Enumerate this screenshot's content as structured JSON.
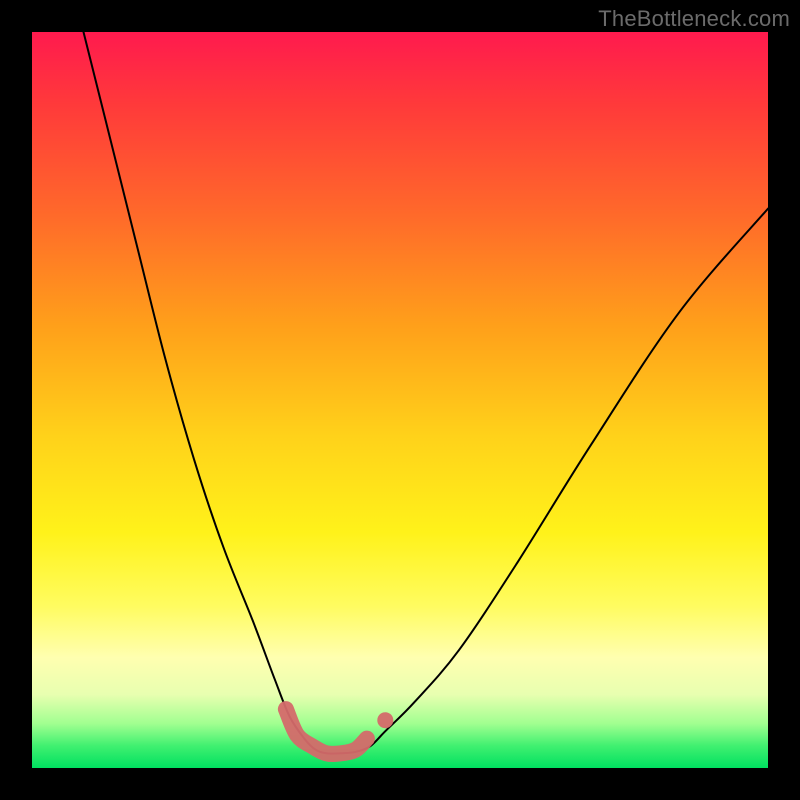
{
  "watermark": "TheBottleneck.com",
  "colors": {
    "background": "#000000",
    "curve": "#000000",
    "marker": "#d46a6a",
    "gradient_top": "#ff1a4e",
    "gradient_bottom": "#00e060"
  },
  "chart_data": {
    "type": "line",
    "title": "",
    "xlabel": "",
    "ylabel": "",
    "xlim": [
      0,
      100
    ],
    "ylim": [
      0,
      100
    ],
    "grid": false,
    "series": [
      {
        "name": "bottleneck-curve",
        "x": [
          7,
          10,
          14,
          18,
          22,
          26,
          30,
          33,
          35,
          37,
          38.5,
          40,
          42,
          44,
          46,
          48,
          52,
          58,
          66,
          76,
          88,
          100
        ],
        "y": [
          100,
          88,
          72,
          56,
          42,
          30,
          20,
          12,
          7,
          4,
          2.5,
          2,
          2,
          2.2,
          3,
          5,
          9,
          16,
          28,
          44,
          62,
          76
        ]
      }
    ],
    "markers": {
      "name": "optimal-range",
      "x": [
        34.5,
        36,
        38,
        40,
        42,
        44,
        45.5
      ],
      "y": [
        8,
        4.5,
        3,
        2,
        2,
        2.5,
        4
      ],
      "extra_dot": {
        "x": 48,
        "y": 6.5
      }
    }
  }
}
